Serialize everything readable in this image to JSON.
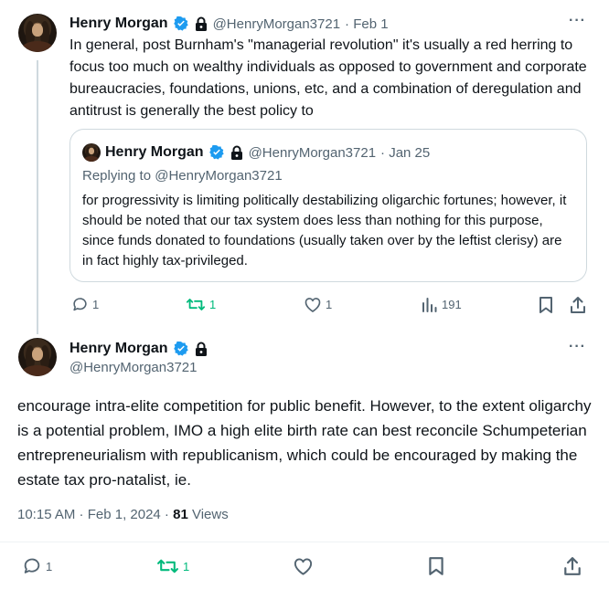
{
  "tweet1": {
    "author": "Henry Morgan",
    "handle": "@HenryMorgan3721",
    "date": "· Feb 1",
    "text": "In general, post Burnham's \"managerial revolution\" it's usually a red herring to focus too much on wealthy individuals as opposed to government and corporate bureaucracies, foundations, unions, etc, and a combination of deregulation and antitrust is generally the best policy to",
    "quote": {
      "author": "Henry Morgan",
      "handle": "@HenryMorgan3721",
      "date": "· Jan 25",
      "replying": "Replying to @HenryMorgan3721",
      "text": "for progressivity is limiting politically destabilizing oligarchic fortunes; however, it should be noted that our tax system does less than nothing for this purpose, since funds donated to foundations (usually taken over by the leftist clerisy) are in fact highly tax-privileged."
    },
    "actions": {
      "replies": "1",
      "reposts": "1",
      "likes": "1",
      "views": "191"
    }
  },
  "tweet2": {
    "author": "Henry Morgan",
    "handle": "@HenryMorgan3721",
    "text": "encourage intra-elite competition for public benefit. However, to the extent oligarchy is a potential problem, IMO a high elite birth rate can best reconcile Schumpeterian entrepreneurialism with republicanism, which could be encouraged by making the estate tax pro-natalist, ie.",
    "timestamp": "10:15 AM · Feb 1, 2024 · ",
    "views_count": "81",
    "views_label": "Views",
    "actions": {
      "replies": "1",
      "reposts": "1"
    }
  },
  "more_glyph": "···",
  "colors": {
    "verified": "#1d9bf0",
    "repost": "#00ba7c",
    "muted": "#536471",
    "border": "#cfd9de"
  }
}
